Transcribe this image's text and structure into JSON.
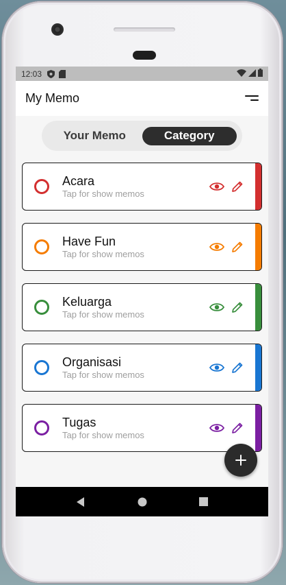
{
  "status": {
    "time": "12:03"
  },
  "appbar": {
    "title": "My Memo"
  },
  "tabs": [
    {
      "label": "Your Memo",
      "active": false
    },
    {
      "label": "Category",
      "active": true
    }
  ],
  "categories": [
    {
      "name": "Acara",
      "subtitle": "Tap for show memos",
      "color": "#d32f2f"
    },
    {
      "name": "Have Fun",
      "subtitle": "Tap for show memos",
      "color": "#f57c00"
    },
    {
      "name": "Keluarga",
      "subtitle": "Tap for show memos",
      "color": "#388e3c"
    },
    {
      "name": "Organisasi",
      "subtitle": "Tap for show memos",
      "color": "#1976d2"
    },
    {
      "name": "Tugas",
      "subtitle": "Tap for show memos",
      "color": "#7b1fa2"
    }
  ],
  "icons": {
    "view": "eye-icon",
    "edit": "pencil-icon",
    "fab": "plus-icon",
    "menu": "menu-icon",
    "nav": [
      "back-icon",
      "home-icon",
      "recents-icon"
    ]
  }
}
